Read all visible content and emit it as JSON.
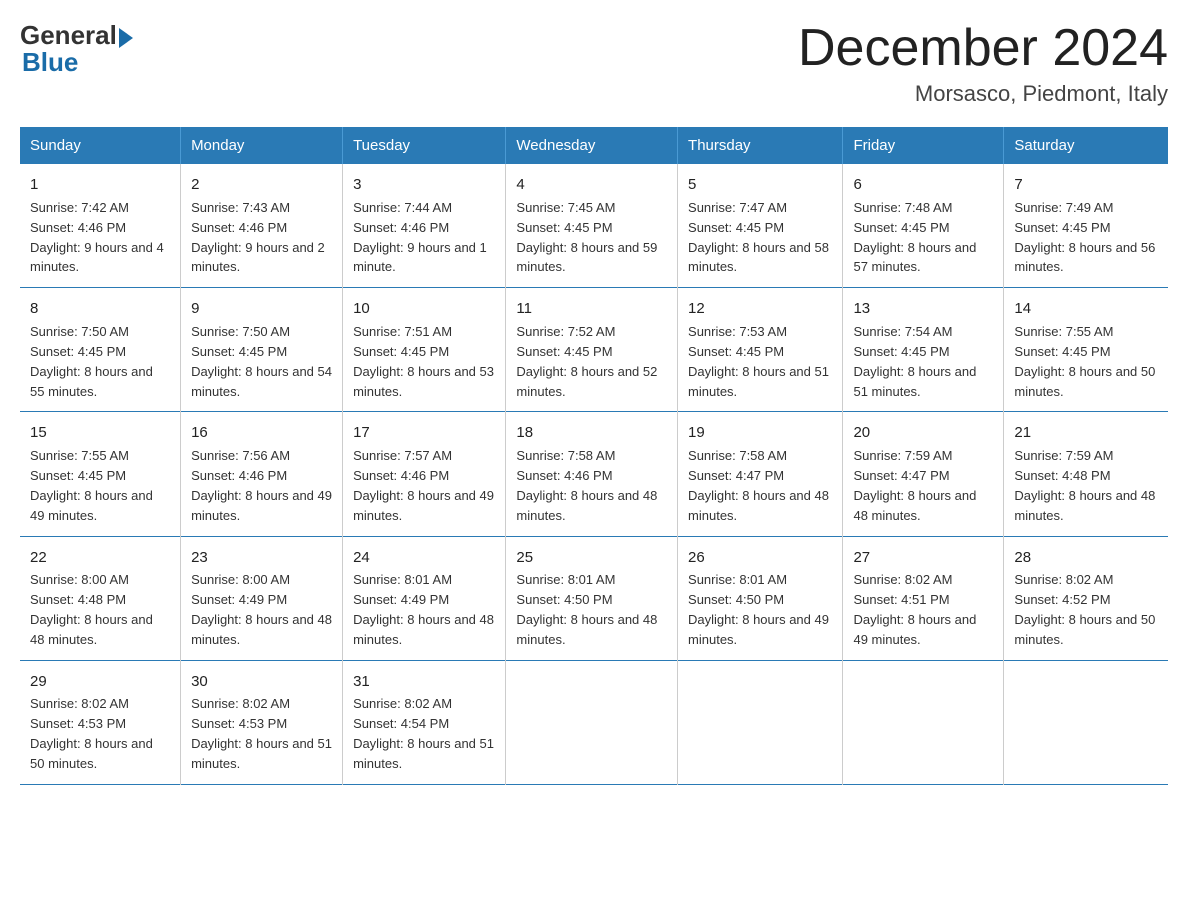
{
  "logo": {
    "general": "General",
    "blue": "Blue"
  },
  "title": "December 2024",
  "subtitle": "Morsasco, Piedmont, Italy",
  "days_header": [
    "Sunday",
    "Monday",
    "Tuesday",
    "Wednesday",
    "Thursday",
    "Friday",
    "Saturday"
  ],
  "weeks": [
    [
      {
        "day": "1",
        "sunrise": "7:42 AM",
        "sunset": "4:46 PM",
        "daylight": "9 hours and 4 minutes."
      },
      {
        "day": "2",
        "sunrise": "7:43 AM",
        "sunset": "4:46 PM",
        "daylight": "9 hours and 2 minutes."
      },
      {
        "day": "3",
        "sunrise": "7:44 AM",
        "sunset": "4:46 PM",
        "daylight": "9 hours and 1 minute."
      },
      {
        "day": "4",
        "sunrise": "7:45 AM",
        "sunset": "4:45 PM",
        "daylight": "8 hours and 59 minutes."
      },
      {
        "day": "5",
        "sunrise": "7:47 AM",
        "sunset": "4:45 PM",
        "daylight": "8 hours and 58 minutes."
      },
      {
        "day": "6",
        "sunrise": "7:48 AM",
        "sunset": "4:45 PM",
        "daylight": "8 hours and 57 minutes."
      },
      {
        "day": "7",
        "sunrise": "7:49 AM",
        "sunset": "4:45 PM",
        "daylight": "8 hours and 56 minutes."
      }
    ],
    [
      {
        "day": "8",
        "sunrise": "7:50 AM",
        "sunset": "4:45 PM",
        "daylight": "8 hours and 55 minutes."
      },
      {
        "day": "9",
        "sunrise": "7:50 AM",
        "sunset": "4:45 PM",
        "daylight": "8 hours and 54 minutes."
      },
      {
        "day": "10",
        "sunrise": "7:51 AM",
        "sunset": "4:45 PM",
        "daylight": "8 hours and 53 minutes."
      },
      {
        "day": "11",
        "sunrise": "7:52 AM",
        "sunset": "4:45 PM",
        "daylight": "8 hours and 52 minutes."
      },
      {
        "day": "12",
        "sunrise": "7:53 AM",
        "sunset": "4:45 PM",
        "daylight": "8 hours and 51 minutes."
      },
      {
        "day": "13",
        "sunrise": "7:54 AM",
        "sunset": "4:45 PM",
        "daylight": "8 hours and 51 minutes."
      },
      {
        "day": "14",
        "sunrise": "7:55 AM",
        "sunset": "4:45 PM",
        "daylight": "8 hours and 50 minutes."
      }
    ],
    [
      {
        "day": "15",
        "sunrise": "7:55 AM",
        "sunset": "4:45 PM",
        "daylight": "8 hours and 49 minutes."
      },
      {
        "day": "16",
        "sunrise": "7:56 AM",
        "sunset": "4:46 PM",
        "daylight": "8 hours and 49 minutes."
      },
      {
        "day": "17",
        "sunrise": "7:57 AM",
        "sunset": "4:46 PM",
        "daylight": "8 hours and 49 minutes."
      },
      {
        "day": "18",
        "sunrise": "7:58 AM",
        "sunset": "4:46 PM",
        "daylight": "8 hours and 48 minutes."
      },
      {
        "day": "19",
        "sunrise": "7:58 AM",
        "sunset": "4:47 PM",
        "daylight": "8 hours and 48 minutes."
      },
      {
        "day": "20",
        "sunrise": "7:59 AM",
        "sunset": "4:47 PM",
        "daylight": "8 hours and 48 minutes."
      },
      {
        "day": "21",
        "sunrise": "7:59 AM",
        "sunset": "4:48 PM",
        "daylight": "8 hours and 48 minutes."
      }
    ],
    [
      {
        "day": "22",
        "sunrise": "8:00 AM",
        "sunset": "4:48 PM",
        "daylight": "8 hours and 48 minutes."
      },
      {
        "day": "23",
        "sunrise": "8:00 AM",
        "sunset": "4:49 PM",
        "daylight": "8 hours and 48 minutes."
      },
      {
        "day": "24",
        "sunrise": "8:01 AM",
        "sunset": "4:49 PM",
        "daylight": "8 hours and 48 minutes."
      },
      {
        "day": "25",
        "sunrise": "8:01 AM",
        "sunset": "4:50 PM",
        "daylight": "8 hours and 48 minutes."
      },
      {
        "day": "26",
        "sunrise": "8:01 AM",
        "sunset": "4:50 PM",
        "daylight": "8 hours and 49 minutes."
      },
      {
        "day": "27",
        "sunrise": "8:02 AM",
        "sunset": "4:51 PM",
        "daylight": "8 hours and 49 minutes."
      },
      {
        "day": "28",
        "sunrise": "8:02 AM",
        "sunset": "4:52 PM",
        "daylight": "8 hours and 50 minutes."
      }
    ],
    [
      {
        "day": "29",
        "sunrise": "8:02 AM",
        "sunset": "4:53 PM",
        "daylight": "8 hours and 50 minutes."
      },
      {
        "day": "30",
        "sunrise": "8:02 AM",
        "sunset": "4:53 PM",
        "daylight": "8 hours and 51 minutes."
      },
      {
        "day": "31",
        "sunrise": "8:02 AM",
        "sunset": "4:54 PM",
        "daylight": "8 hours and 51 minutes."
      },
      null,
      null,
      null,
      null
    ]
  ],
  "labels": {
    "sunrise": "Sunrise:",
    "sunset": "Sunset:",
    "daylight": "Daylight:"
  }
}
